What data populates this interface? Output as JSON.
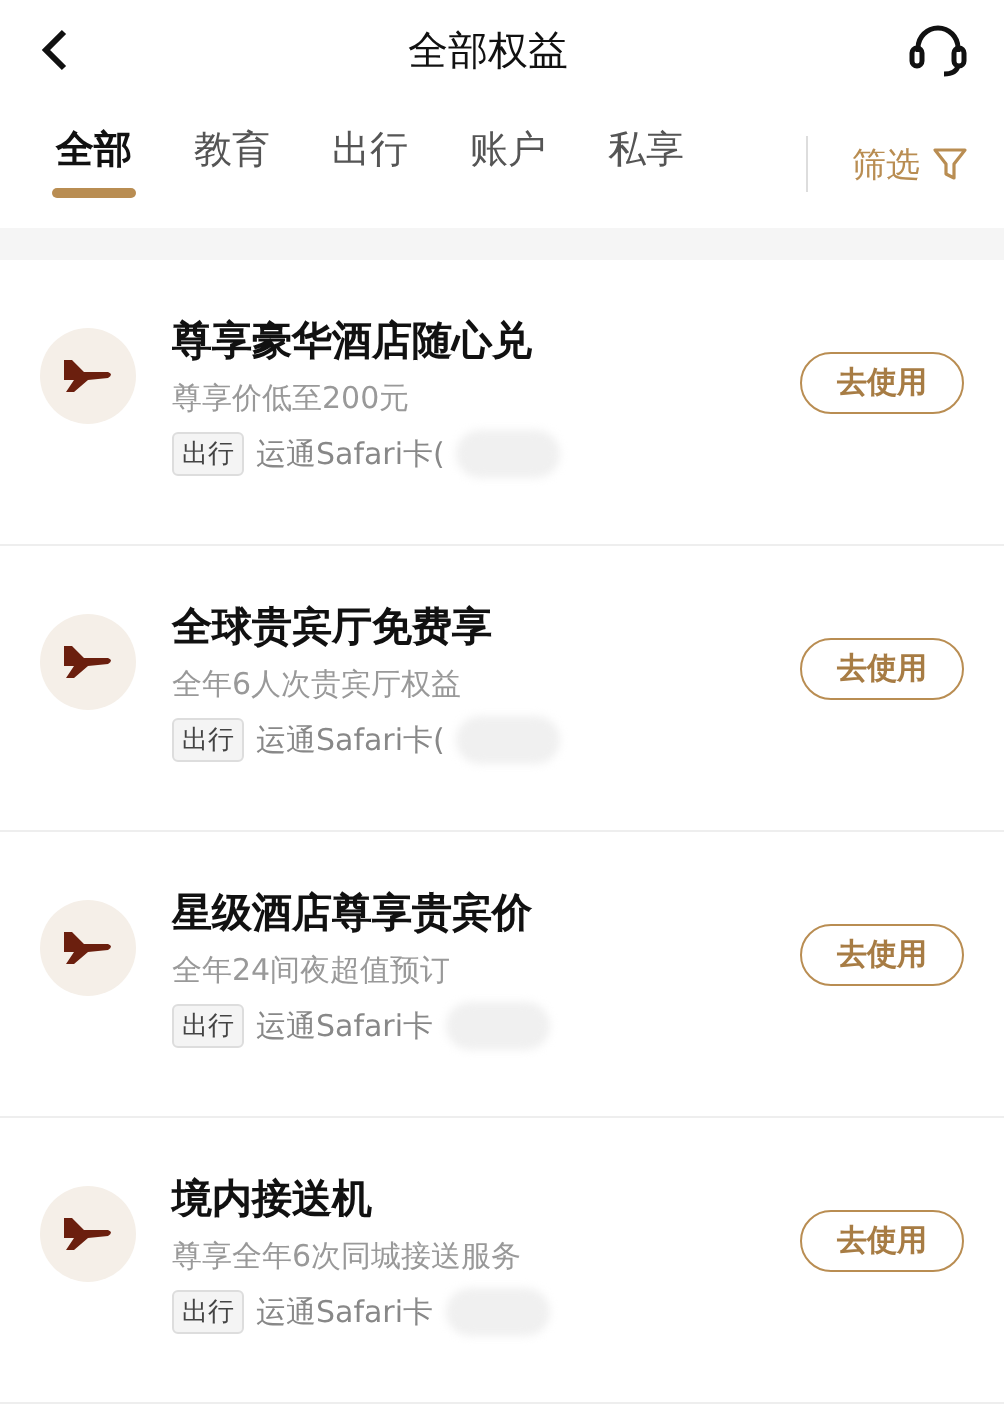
{
  "header": {
    "title": "全部权益"
  },
  "tabs": [
    {
      "label": "全部",
      "selected": true
    },
    {
      "label": "教育",
      "selected": false
    },
    {
      "label": "出行",
      "selected": false
    },
    {
      "label": "账户",
      "selected": false
    },
    {
      "label": "私享",
      "selected": false
    }
  ],
  "filter": {
    "label": "筛选"
  },
  "items": [
    {
      "title": "尊享豪华酒店随心兑",
      "subtitle": "尊享价低至200元",
      "tag": "出行",
      "card": "运通Safari卡(",
      "button": "去使用"
    },
    {
      "title": "全球贵宾厅免费享",
      "subtitle": "全年6人次贵宾厅权益",
      "tag": "出行",
      "card": "运通Safari卡(",
      "button": "去使用"
    },
    {
      "title": "星级酒店尊享贵宾价",
      "subtitle": "全年24间夜超值预订",
      "tag": "出行",
      "card": "运通Safari卡",
      "button": "去使用"
    },
    {
      "title": "境内接送机",
      "subtitle": "尊享全年6次同城接送服务",
      "tag": "出行",
      "card": "运通Safari卡",
      "button": "去使用"
    }
  ]
}
